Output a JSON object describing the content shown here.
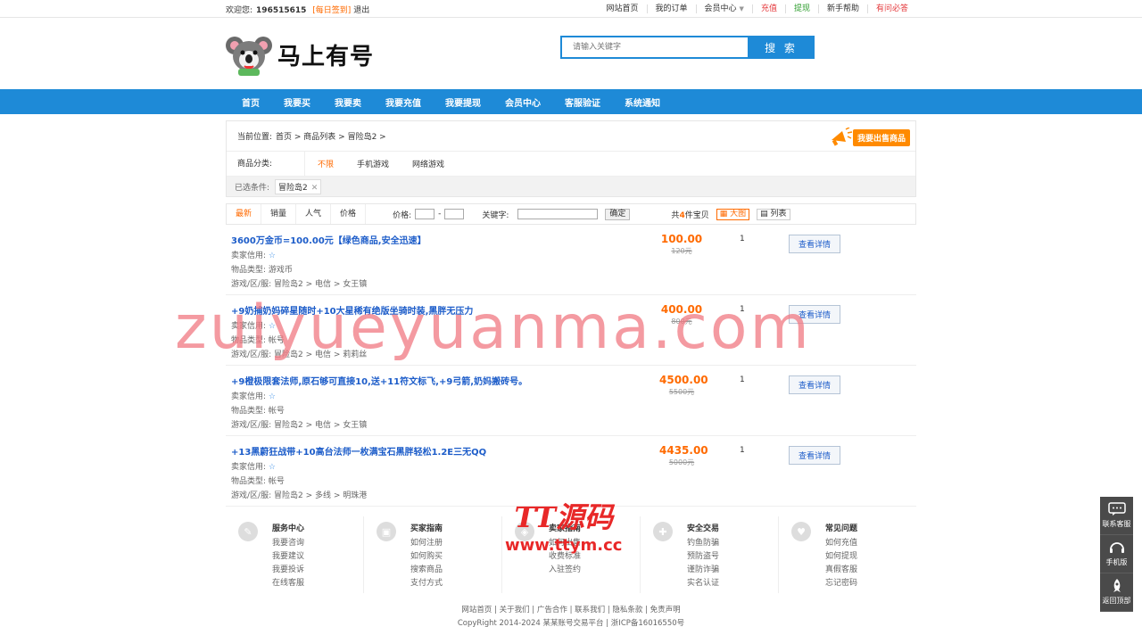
{
  "topbar": {
    "welcome": "欢迎您:",
    "uid": "196515615",
    "sign": "[每日签到]",
    "logout": "退出",
    "links": [
      {
        "label": "网站首页",
        "style": ""
      },
      {
        "label": "我的订单",
        "style": ""
      },
      {
        "label": "会员中心",
        "style": "",
        "arrow": "▼"
      },
      {
        "label": "充值",
        "style": "red"
      },
      {
        "label": "提现",
        "style": "green"
      },
      {
        "label": "新手帮助",
        "style": ""
      },
      {
        "label": "有问必答",
        "style": "red"
      }
    ]
  },
  "header": {
    "logo_text": "马上有号",
    "search_placeholder": "请输入关键字",
    "search_button": "搜 索"
  },
  "nav": [
    "首页",
    "我要买",
    "我要卖",
    "我要充值",
    "我要提现",
    "会员中心",
    "客服验证",
    "系统通知"
  ],
  "crumb": {
    "label": "当前位置:",
    "path": "首页 > 商品列表 > 冒险岛2 >",
    "sell_badge": "我要出售商品"
  },
  "category": {
    "label": "商品分类:",
    "options": [
      {
        "label": "不限",
        "active": true
      },
      {
        "label": "手机游戏",
        "active": false
      },
      {
        "label": "网络游戏",
        "active": false
      }
    ]
  },
  "selected": {
    "label": "已选条件:",
    "tag": "冒险岛2",
    "remove": "✕"
  },
  "filter": {
    "sorts": [
      {
        "label": "最新",
        "active": true
      },
      {
        "label": "销量",
        "active": false
      },
      {
        "label": "人气",
        "active": false
      },
      {
        "label": "价格",
        "active": false
      }
    ],
    "price_label": "价格:",
    "dash": "-",
    "keyword_label": "关键字:",
    "ok": "确定",
    "count_prefix": "共",
    "count": "4",
    "count_suffix": "件宝贝",
    "view_big": "大图",
    "view_list": "列表"
  },
  "list_labels": {
    "credit": "卖家信用:",
    "type": "物品类型:",
    "server": "游戏/区/服:",
    "detail": "查看详情"
  },
  "items": [
    {
      "title": "3600万金币=100.00元【绿色商品,安全迅速】",
      "type": "游戏币",
      "server": "冒险岛2 > 电信 > 女王镇",
      "price": "100.00",
      "old": "120元",
      "qty": "1"
    },
    {
      "title": "+9奶捕奶妈碎星随时+10大星稀有绝版坐骑时装,黑胖无压力",
      "type": "帐号",
      "server": "冒险岛2 > 电信 > 莉莉丝",
      "price": "400.00",
      "old": "800元",
      "qty": "1"
    },
    {
      "title": "+9橙极限套法师,原石够可直接10,送+11符文标飞,+9弓箭,奶妈搬砖号。",
      "type": "帐号",
      "server": "冒险岛2 > 电信 > 女王镇",
      "price": "4500.00",
      "old": "5500元",
      "qty": "1"
    },
    {
      "title": "+13黑蔚狂战带+10高台法师一枚满宝石黑胖轻松1.2E三无QQ",
      "type": "帐号",
      "server": "冒险岛2 > 多线 > 明珠港",
      "price": "4435.00",
      "old": "5000元",
      "qty": "1"
    }
  ],
  "help": [
    {
      "title": "服务中心",
      "icon": "compass-icon",
      "glyph": "✎",
      "links": [
        "我要咨询",
        "我要建议",
        "我要投诉",
        "在线客服"
      ]
    },
    {
      "title": "买家指南",
      "icon": "bus-icon",
      "glyph": "▣",
      "links": [
        "如何注册",
        "如何购买",
        "搜索商品",
        "支付方式"
      ]
    },
    {
      "title": "卖家指南",
      "icon": "seller-icon",
      "glyph": "◈",
      "links": [
        "如何出售",
        "收费标准",
        "入驻签约"
      ]
    },
    {
      "title": "安全交易",
      "icon": "wrench-icon",
      "glyph": "✚",
      "links": [
        "钓鱼防骗",
        "预防盗号",
        "谨防诈骗",
        "实名认证"
      ]
    },
    {
      "title": "常见问题",
      "icon": "heart-icon",
      "glyph": "♥",
      "links": [
        "如何充值",
        "如何提现",
        "真假客服",
        "忘记密码"
      ]
    }
  ],
  "footer": {
    "links": "网站首页 | 关于我们 | 广告合作 | 联系我们 | 隐私条款 | 免责声明",
    "copyright": "CopyRight 2014-2024 某某账号交易平台 | 浙ICP备16016550号"
  },
  "watermark": {
    "main": "zuiyueyuanma.com",
    "logo": "TT源码",
    "url": "www.ttym.cc"
  },
  "side": [
    "联系客服",
    "手机版",
    "返回顶部"
  ]
}
